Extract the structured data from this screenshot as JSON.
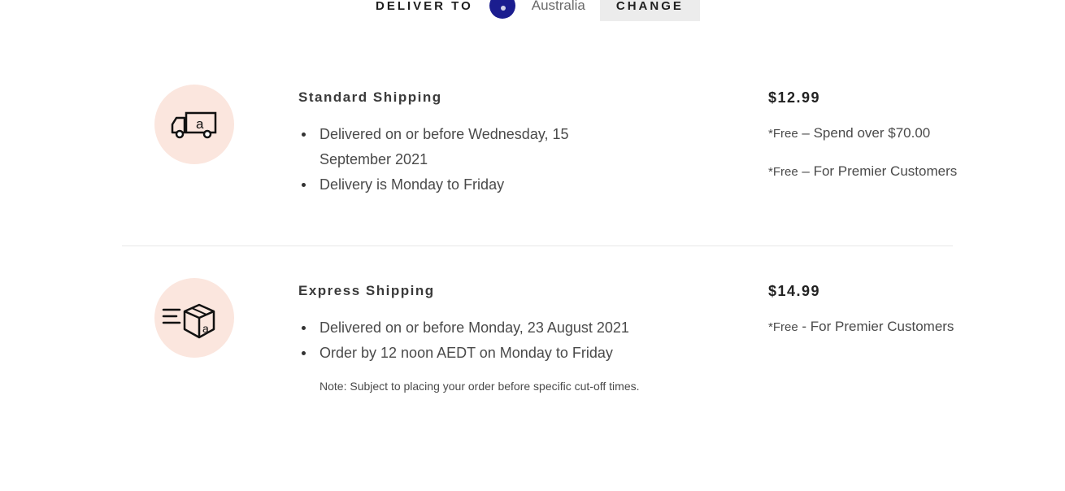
{
  "deliver_bar": {
    "label": "DELIVER TO",
    "country": "Australia",
    "change_label": "CHANGE",
    "flag_color": "#1b1d8f",
    "flag_icon": "australia-flag-icon"
  },
  "shipping_options": [
    {
      "icon": "delivery-truck-icon",
      "title": "Standard Shipping",
      "bullets": [
        "Delivered on or before Wednesday, 15 September 2021",
        "Delivery is Monday to Friday"
      ],
      "price": "$12.99",
      "price_notes": [
        {
          "prefix": "*Free",
          "text": " – Spend over $70.00"
        },
        {
          "prefix": "*Free",
          "text": " – For Premier Customers"
        }
      ]
    },
    {
      "icon": "express-box-icon",
      "title": "Express Shipping",
      "bullets": [
        "Delivered on or before Monday, 23 August 2021",
        "Order by 12 noon AEDT on Monday to Friday"
      ],
      "note": "Note: Subject to placing your order before specific cut-off times.",
      "price": "$14.99",
      "price_notes": [
        {
          "prefix": "*Free",
          "text": " - For Premier Customers"
        }
      ]
    }
  ],
  "colors": {
    "icon_circle": "#fbe6de",
    "change_button_bg": "#ececec"
  }
}
